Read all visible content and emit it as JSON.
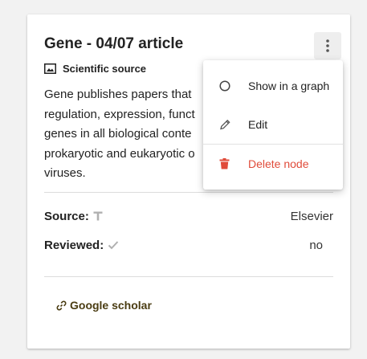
{
  "card": {
    "title": "Gene - 04/07 article",
    "source_type": "Scientific source",
    "description_lines": [
      "Gene publishes papers that",
      "regulation, expression, funct",
      "genes in all biological conte",
      "prokaryotic and eukaryotic o",
      "viruses."
    ],
    "fields": [
      {
        "label": "Source:",
        "icon": "text-icon",
        "value": "Elsevier"
      },
      {
        "label": "Reviewed:",
        "icon": "check-icon",
        "value": "no"
      }
    ],
    "link_label": "Google scholar"
  },
  "menu": {
    "items": [
      {
        "label": "Show in a graph",
        "icon": "circle-icon"
      },
      {
        "label": "Edit",
        "icon": "pencil-icon"
      },
      {
        "label": "Delete node",
        "icon": "trash-icon"
      }
    ]
  },
  "colors": {
    "danger": "#e04b3a",
    "link": "#4a3c12",
    "icon_gray": "#b0b0b0"
  }
}
